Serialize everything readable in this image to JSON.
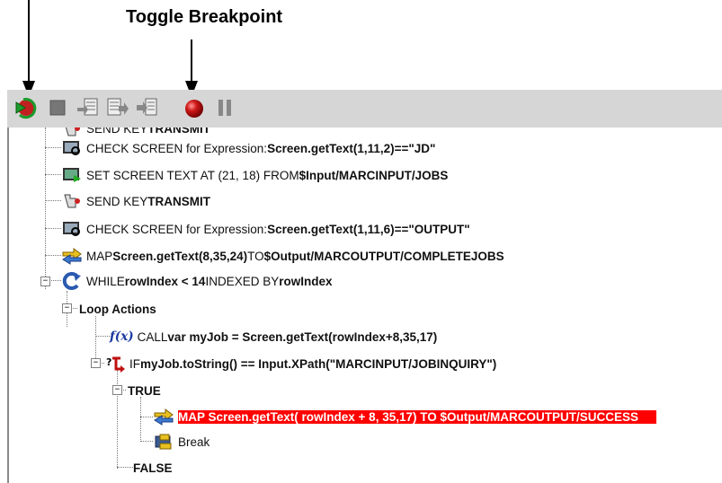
{
  "callout": {
    "label": "Toggle Breakpoint"
  },
  "toolbar": {
    "buttons": [
      {
        "name": "run-icon"
      },
      {
        "name": "stop-icon"
      },
      {
        "name": "step-into-icon"
      },
      {
        "name": "step-over-icon"
      },
      {
        "name": "step-out-icon"
      },
      {
        "name": "toggle-breakpoint-icon"
      },
      {
        "name": "pause-icon"
      }
    ]
  },
  "tree": {
    "r0": {
      "a": "SEND KEY ",
      "b": "TRANSMIT"
    },
    "r1": {
      "a": "CHECK SCREEN for Expression: ",
      "b": "Screen.getText(1,11,2)==\"JD\""
    },
    "r2": {
      "a": "SET SCREEN TEXT AT (21, 18) FROM ",
      "b": "$Input/MARCINPUT/JOBS"
    },
    "r3": {
      "a": "SEND KEY ",
      "b": "TRANSMIT"
    },
    "r4": {
      "a": "CHECK SCREEN for Expression: ",
      "b": "Screen.getText(1,11,6)==\"OUTPUT\""
    },
    "r5": {
      "a": "MAP ",
      "b": "Screen.getText(8,35,24)",
      "c": " TO ",
      "d": "$Output/MARCOUTPUT/COMPLETEJOBS"
    },
    "r6": {
      "a": "WHILE ",
      "b": "rowIndex < 14",
      "c": " INDEXED BY ",
      "d": "rowIndex"
    },
    "r7": {
      "a": "Loop Actions"
    },
    "r8": {
      "a": "CALL ",
      "b": "var myJob = Screen.getText(rowIndex+8,35,17)"
    },
    "r9": {
      "a": "IF ",
      "b": "myJob.toString() == Input.XPath(\"MARCINPUT/JOBINQUIRY\")"
    },
    "r10": {
      "a": "TRUE"
    },
    "r11": {
      "a": "MAP Screen.getText( rowIndex + 8, 35,17) TO $Output/MARCOUTPUT/SUCCESS"
    },
    "r12": {
      "a": "Break"
    },
    "r13": {
      "a": "FALSE"
    }
  },
  "colors": {
    "highlight": "#ff0000",
    "toolbar": "#d6d6d6"
  }
}
